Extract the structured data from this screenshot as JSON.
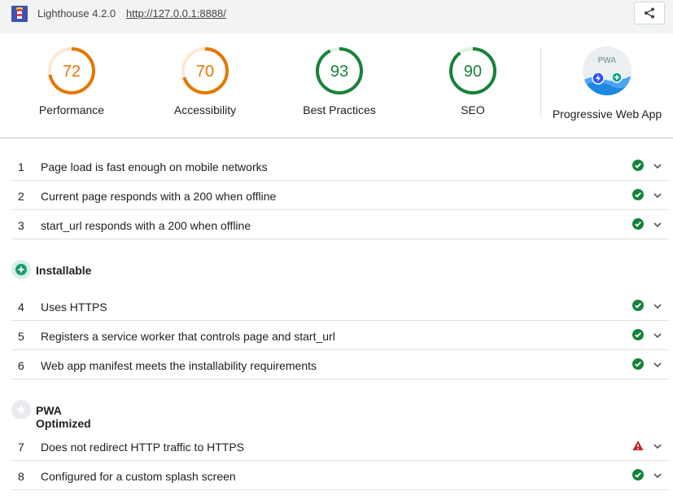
{
  "topbar": {
    "app_title": "Lighthouse 4.2.0",
    "url": "http://127.0.0.1:8888/",
    "share_icon": "share-icon"
  },
  "scores": [
    {
      "label": "Performance",
      "value": "72",
      "score": 0.72,
      "color": "#e67700"
    },
    {
      "label": "Accessibility",
      "value": "70",
      "score": 0.7,
      "color": "#e67700"
    },
    {
      "label": "Best Practices",
      "value": "93",
      "score": 0.93,
      "color": "#178239"
    },
    {
      "label": "SEO",
      "value": "90",
      "score": 0.9,
      "color": "#178239"
    }
  ],
  "pwa": {
    "label": "Progressive Web App",
    "badge_text": "PWA"
  },
  "groups": {
    "installable": {
      "title": "Installable",
      "icon": "plus-circle-icon"
    },
    "pwa_optimized": {
      "title": "PWA Optimized",
      "icon": "star-icon"
    }
  },
  "audits": [
    {
      "index": "1",
      "title": "Page load is fast enough on mobile networks",
      "status": "pass"
    },
    {
      "index": "2",
      "title": "Current page responds with a 200 when offline",
      "status": "pass"
    },
    {
      "index": "3",
      "title": "start_url responds with a 200 when offline",
      "status": "pass"
    },
    {
      "index": "4",
      "title": "Uses HTTPS",
      "status": "pass"
    },
    {
      "index": "5",
      "title": "Registers a service worker that controls page and start_url",
      "status": "pass"
    },
    {
      "index": "6",
      "title": "Web app manifest meets the installability requirements",
      "status": "pass"
    },
    {
      "index": "7",
      "title": "Does not redirect HTTP traffic to HTTPS",
      "status": "fail"
    },
    {
      "index": "8",
      "title": "Configured for a custom splash screen",
      "status": "pass"
    }
  ],
  "colors": {
    "pass": "#178239",
    "fail": "#c7221f",
    "average": "#e67700",
    "installable_icon": "#1b9e6e"
  }
}
